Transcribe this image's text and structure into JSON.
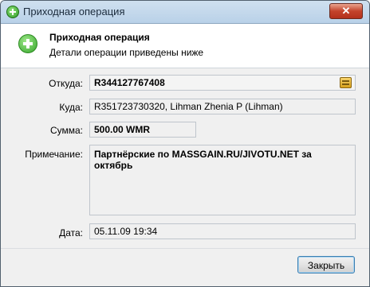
{
  "window": {
    "title": "Приходная операция",
    "close_label": "✕"
  },
  "header": {
    "title": "Приходная операция",
    "subtitle": "Детали операции приведены ниже",
    "icon": "plus-circle-icon"
  },
  "fields": {
    "from": {
      "label": "Откуда:",
      "value": "R344127767408"
    },
    "to": {
      "label": "Куда:",
      "value": "R351723730320, Lihman Zhenia P (Lihman)"
    },
    "amount": {
      "label": "Сумма:",
      "value": "500.00 WMR"
    },
    "note": {
      "label": "Примечание:",
      "value": "Партнёрские по MASSGAIN.RU/JIVOTU.NET за октябрь"
    },
    "date": {
      "label": "Дата:",
      "value": "05.11.09 19:34"
    }
  },
  "buttons": {
    "close": "Закрыть"
  },
  "colors": {
    "accent": "#2f9a25",
    "close_button": "#c4432b",
    "title_bar": "#c4d8eb"
  }
}
